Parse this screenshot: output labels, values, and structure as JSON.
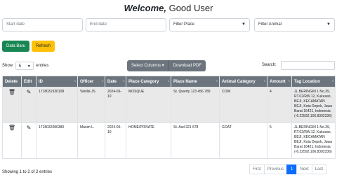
{
  "header": {
    "greeting": "Welcome,",
    "user": "Good User"
  },
  "filters": {
    "start_date": "Start date",
    "end_date": "End date",
    "place": "Filter Place",
    "animal": "Filter Animal"
  },
  "buttons": {
    "new_data": "Data Baru",
    "refresh": "Refresh",
    "select_columns": "Select Columns ▾",
    "download_pdf": "Download PDF"
  },
  "length": {
    "show": "Show",
    "value": "5",
    "entries": "entries"
  },
  "search": {
    "label": "Search:"
  },
  "table": {
    "headers": [
      "Delete",
      "Edit",
      "ID",
      "Officer",
      "Date",
      "Place Category",
      "Place Name",
      "Animal Category",
      "Amount",
      "Tag Location"
    ],
    "rows": [
      {
        "id": "1718031930108",
        "officer": "Vanilla JS",
        "date": "2024-06-10",
        "place_category": "MOSQUE",
        "place_name": "St. Qwerty 123 456 789",
        "animal_category": "COW",
        "amount": "4",
        "tag_location": "JL.BERINGIN 1 No.39, RT.02/RW.12, Kukusan, BEJI, KECAMATAN BEJI, Kota Depok, Jawa Barat 16421, Indonesia (-6.22592,106.8302336)"
      },
      {
        "id": "1718032080380",
        "officer": "Maxim L.",
        "date": "2024-06-10",
        "place_category": "HOME/PRIVATE",
        "place_name": "St. Asd 321 678",
        "animal_category": "GOAT",
        "amount": "5",
        "tag_location": "JL.BERINGIN 1 No.39, RT.02/RW.12, Kukusan, BEJI, KECAMATAN BEJI, Kota Depok, Jawa Barat 16421, Indonesia (-6.22592,106.8302336)"
      }
    ]
  },
  "footer": {
    "info": "Showing 1 to 2 of 2 entries"
  },
  "pagination": {
    "first": "First",
    "previous": "Previous",
    "current": "1",
    "next": "Next",
    "last": "Last"
  },
  "icons": {
    "delete": "trash-icon",
    "edit": "edit-icon"
  }
}
